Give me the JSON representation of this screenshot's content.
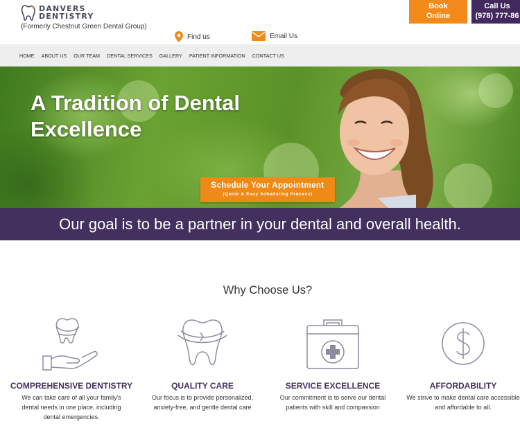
{
  "header": {
    "logo_line1": "DANVERS",
    "logo_line2": "DENTISTRY",
    "formerly": "(Formerly Chestnut Green Dental Group)",
    "find_us": "Find us",
    "email_us": "Email Us",
    "book_line1": "Book",
    "book_line2": "Online",
    "call_line1": "Call Us",
    "call_line2": "(978) 777-86"
  },
  "nav": {
    "items": [
      {
        "label": "HOME"
      },
      {
        "label": "ABOUT US"
      },
      {
        "label": "OUR TEAM"
      },
      {
        "label": "DENTAL SERVICES"
      },
      {
        "label": "GALLERY"
      },
      {
        "label": "PATIENT INFORMATION"
      },
      {
        "label": "CONTACT US"
      }
    ]
  },
  "hero": {
    "title": "A Tradition of Dental Excellence",
    "schedule_main": "Schedule Your Appointment",
    "schedule_sub": "(Quick & Easy Scheduling Process)"
  },
  "goal": {
    "text": "Our goal is to be a partner in your dental and overall health."
  },
  "why": {
    "title": "Why Choose Us?",
    "features": [
      {
        "icon": "hand-tooth-icon",
        "title": "COMPREHENSIVE DENTISTRY",
        "text": "We can take care of all your family's dental needs in one place, including dental emergencies."
      },
      {
        "icon": "tooth-icon",
        "title": "QUALITY CARE",
        "text": "Our focus is to provide personalized, anxiety-free, and gentle dental care"
      },
      {
        "icon": "medical-kit-icon",
        "title": "SERVICE EXCELLENCE",
        "text": "Our commitment is to serve our dental patients with skill and compassion"
      },
      {
        "icon": "dollar-icon",
        "title": "AFFORDABILITY",
        "text": "We strive to make dental care accessible and affordable to all."
      }
    ]
  },
  "colors": {
    "accent_orange": "#f28a1a",
    "brand_purple": "#43305e",
    "nav_bg": "#eeeeee"
  }
}
